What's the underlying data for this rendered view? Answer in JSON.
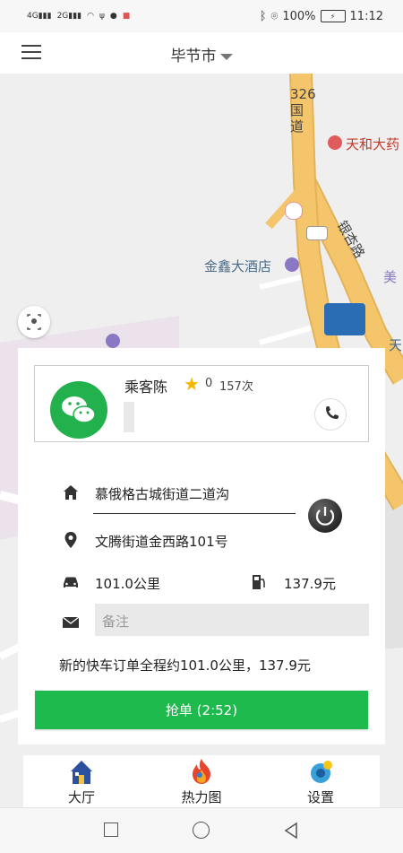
{
  "status_bar": {
    "battery": "100%",
    "time": "11:12"
  },
  "header": {
    "city": "毕节市"
  },
  "map": {
    "labels": {
      "road_326": "326国道",
      "poi_hotel": "金鑫大酒店",
      "poi_pharmacy": "天和大药",
      "road_yinxing": "银杏路",
      "frag_mei": "美",
      "frag_tian": "天"
    }
  },
  "passenger": {
    "name": "乘客陈",
    "rating": "0",
    "trips": "157次"
  },
  "trip": {
    "origin": "慕俄格古城街道二道沟",
    "destination": "文腾街道金西路101号",
    "distance": "101.0公里",
    "price": "137.9元",
    "remark_placeholder": "备注",
    "summary": "新的快车订单全程约101.0公里，137.9元"
  },
  "actions": {
    "grab_label": "抢单 (2:52)"
  },
  "tabs": [
    {
      "label": "大厅"
    },
    {
      "label": "热力图"
    },
    {
      "label": "设置"
    }
  ],
  "colors": {
    "primary_green": "#1fba4d",
    "wechat_green": "#22b14c",
    "road_orange": "#f5c56b",
    "star": "#f5b800"
  }
}
